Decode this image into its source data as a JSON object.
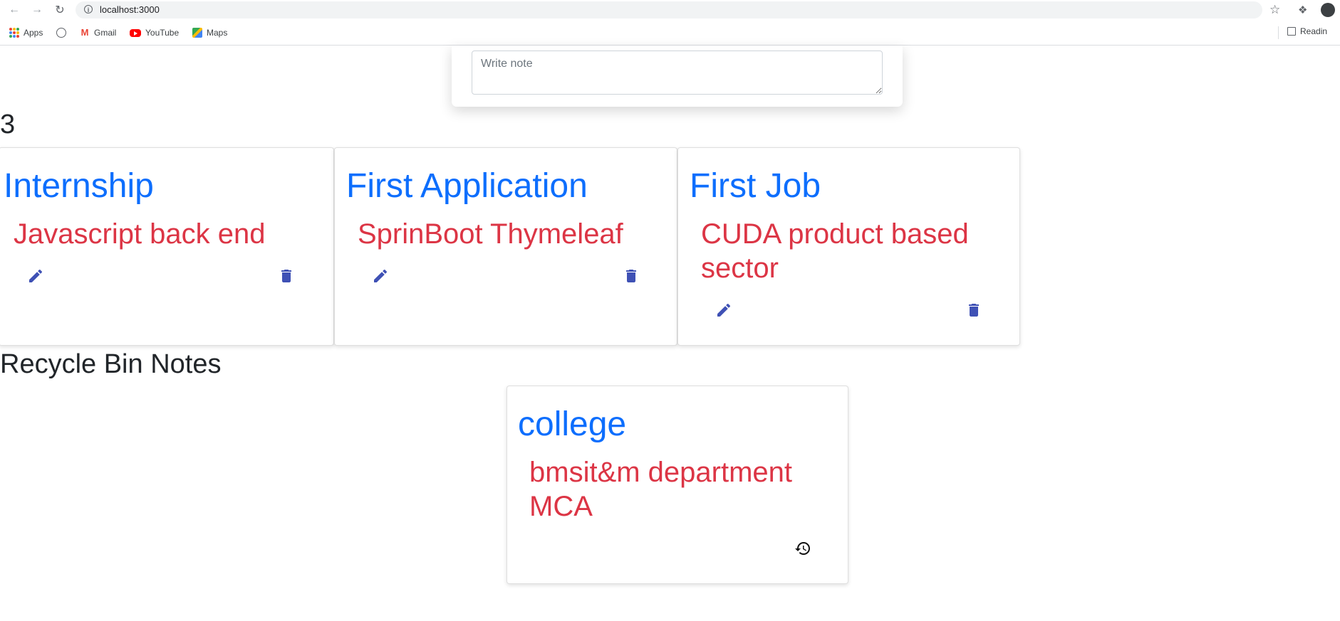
{
  "browser": {
    "url": "localhost:3000",
    "bookmarks": [
      {
        "label": "Apps"
      },
      {
        "label": ""
      },
      {
        "label": "Gmail"
      },
      {
        "label": "YouTube"
      },
      {
        "label": "Maps"
      }
    ],
    "reading_list_label": "Readin"
  },
  "composer": {
    "note_placeholder": "Write note"
  },
  "notes_count": "3",
  "notes": [
    {
      "title": "Internship",
      "text": "Javascript back end"
    },
    {
      "title": "First Application",
      "text": "SprinBoot Thymeleaf"
    },
    {
      "title": "First Job",
      "text": "CUDA product based sector"
    }
  ],
  "recycle_bin": {
    "heading": "Recycle Bin Notes",
    "notes": [
      {
        "title": "college",
        "text": "bmsit&m department MCA"
      }
    ]
  },
  "colors": {
    "title": "#0d6efd",
    "text": "#dc3545",
    "icon": "#3f51b5"
  },
  "icons": {
    "edit": "pencil-icon",
    "delete": "trash-icon",
    "restore": "restore-history-icon"
  }
}
